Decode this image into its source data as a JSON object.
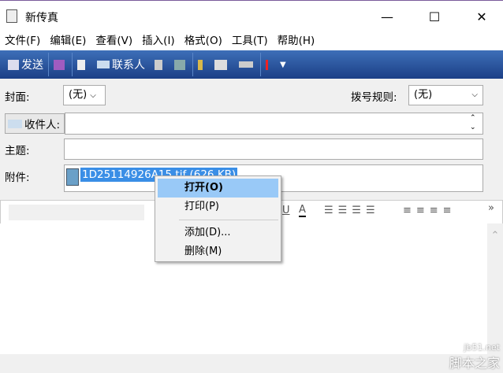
{
  "window": {
    "title": "新传真",
    "minimize": "—",
    "maximize": "☐",
    "close": "✕"
  },
  "menu": [
    "文件(F)",
    "编辑(E)",
    "查看(V)",
    "插入(I)",
    "格式(O)",
    "工具(T)",
    "帮助(H)"
  ],
  "toolbar": {
    "send": "发送",
    "contacts": "联系人"
  },
  "form": {
    "cover_label": "封面:",
    "cover_value": "(无)",
    "dial_rule_label": "拨号规则:",
    "dial_rule_value": "(无)",
    "recipient_button": "收件人:",
    "recipient_value": "",
    "subject_label": "主题:",
    "subject_value": "",
    "attachment_label": "附件:",
    "attachment_value": "1D25114926A15.tif (626 KB)"
  },
  "context_menu": {
    "items": [
      "打开(O)",
      "打印(P)",
      "添加(D)...",
      "删除(M)"
    ]
  },
  "format_bar": {
    "underline": "U",
    "color": "A",
    "more": "»"
  },
  "watermark": {
    "line1": "jb51.net",
    "line2": "脚本之家"
  }
}
